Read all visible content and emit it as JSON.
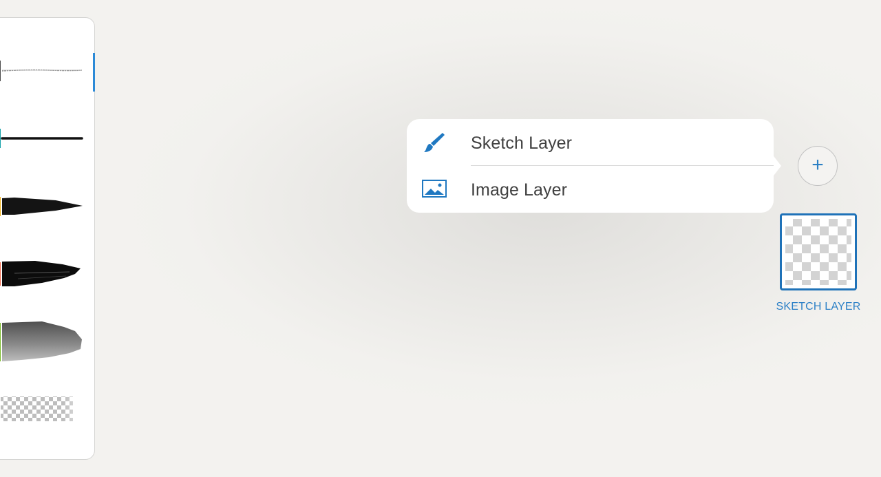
{
  "brush_panel": {
    "brushes": [
      {
        "name": "pencil",
        "color": "#4a4a4a",
        "active": true
      },
      {
        "name": "ink-pen",
        "color": "#13a1a8",
        "active": false
      },
      {
        "name": "brush-pen",
        "color": "#f2b217",
        "active": false
      },
      {
        "name": "paint-brush",
        "color": "#f36a4c",
        "active": false
      },
      {
        "name": "wash-brush",
        "color": "#78bc28",
        "active": false
      },
      {
        "name": "eraser",
        "color": "#cccccc",
        "active": false
      }
    ],
    "accent_color": "#2c8ad7"
  },
  "layer_menu": {
    "items": [
      {
        "label": "Sketch Layer",
        "icon": "paintbrush-icon"
      },
      {
        "label": "Image Layer",
        "icon": "image-icon"
      }
    ]
  },
  "add_layer_button": {
    "symbol": "+",
    "icon": "plus-icon"
  },
  "layers": [
    {
      "caption": "SKETCH LAYER",
      "selected": true
    }
  ],
  "colors": {
    "accent": "#2b7fc4",
    "menu_text": "#404040"
  }
}
